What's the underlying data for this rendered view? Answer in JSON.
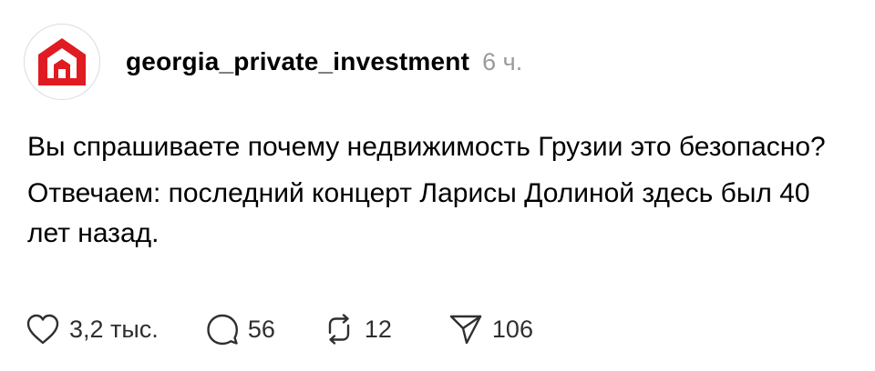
{
  "post": {
    "author": {
      "avatar_icon": "red-house-logo-icon",
      "username": "georgia_private_investment",
      "time": "6 ч."
    },
    "paragraphs": [
      "Вы спрашиваете почему недвижимость Грузии это безопасно?",
      "Отвечаем: последний концерт Ларисы Долиной здесь был 40 лет назад."
    ],
    "actions": {
      "likes": "3,2 тыс.",
      "replies": "56",
      "reposts": "12",
      "shares": "106"
    }
  },
  "colors": {
    "brand_red": "#e11b22",
    "text": "#000000",
    "muted": "#9a9a9a",
    "icon": "#2f2f2f"
  }
}
